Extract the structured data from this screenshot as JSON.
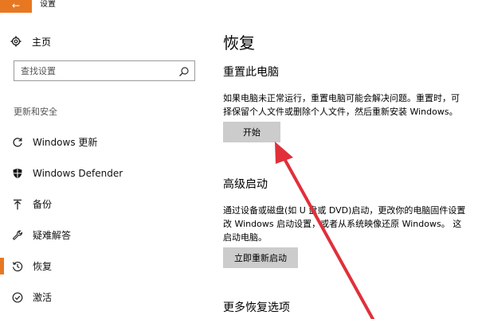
{
  "window": {
    "title": "设置",
    "back_label": "←"
  },
  "sidebar": {
    "home_label": "主页",
    "search_placeholder": "查找设置",
    "section_header": "更新和安全",
    "items": [
      {
        "label": "Windows 更新",
        "icon": "refresh-icon"
      },
      {
        "label": "Windows Defender",
        "icon": "shield-icon"
      },
      {
        "label": "备份",
        "icon": "upload-icon"
      },
      {
        "label": "疑难解答",
        "icon": "wrench-icon"
      },
      {
        "label": "恢复",
        "icon": "history-icon",
        "active": true
      },
      {
        "label": "激活",
        "icon": "check-circle-icon"
      }
    ]
  },
  "main": {
    "page_title": "恢复",
    "reset": {
      "title": "重置此电脑",
      "desc_line1": "如果电脑未正常运行，重置电脑可能会解决问题。重置时，可",
      "desc_line2": "择保留个人文件或删除个人文件，然后重新安装 Windows。",
      "button_label": "开始"
    },
    "advanced": {
      "title": "高级启动",
      "desc_line1": "通过设备或磁盘(如 U 盘或 DVD)启动，更改你的电脑固件设置",
      "desc_line2": "改 Windows 启动设置，或者从系统映像还原 Windows。 这",
      "desc_line3": "启动电脑。",
      "button_label": "立即重新启动"
    },
    "more": {
      "title": "更多恢复选项"
    }
  },
  "colors": {
    "accent": "#e87722",
    "arrow": "#e0303a",
    "button_bg": "#cccccc"
  }
}
